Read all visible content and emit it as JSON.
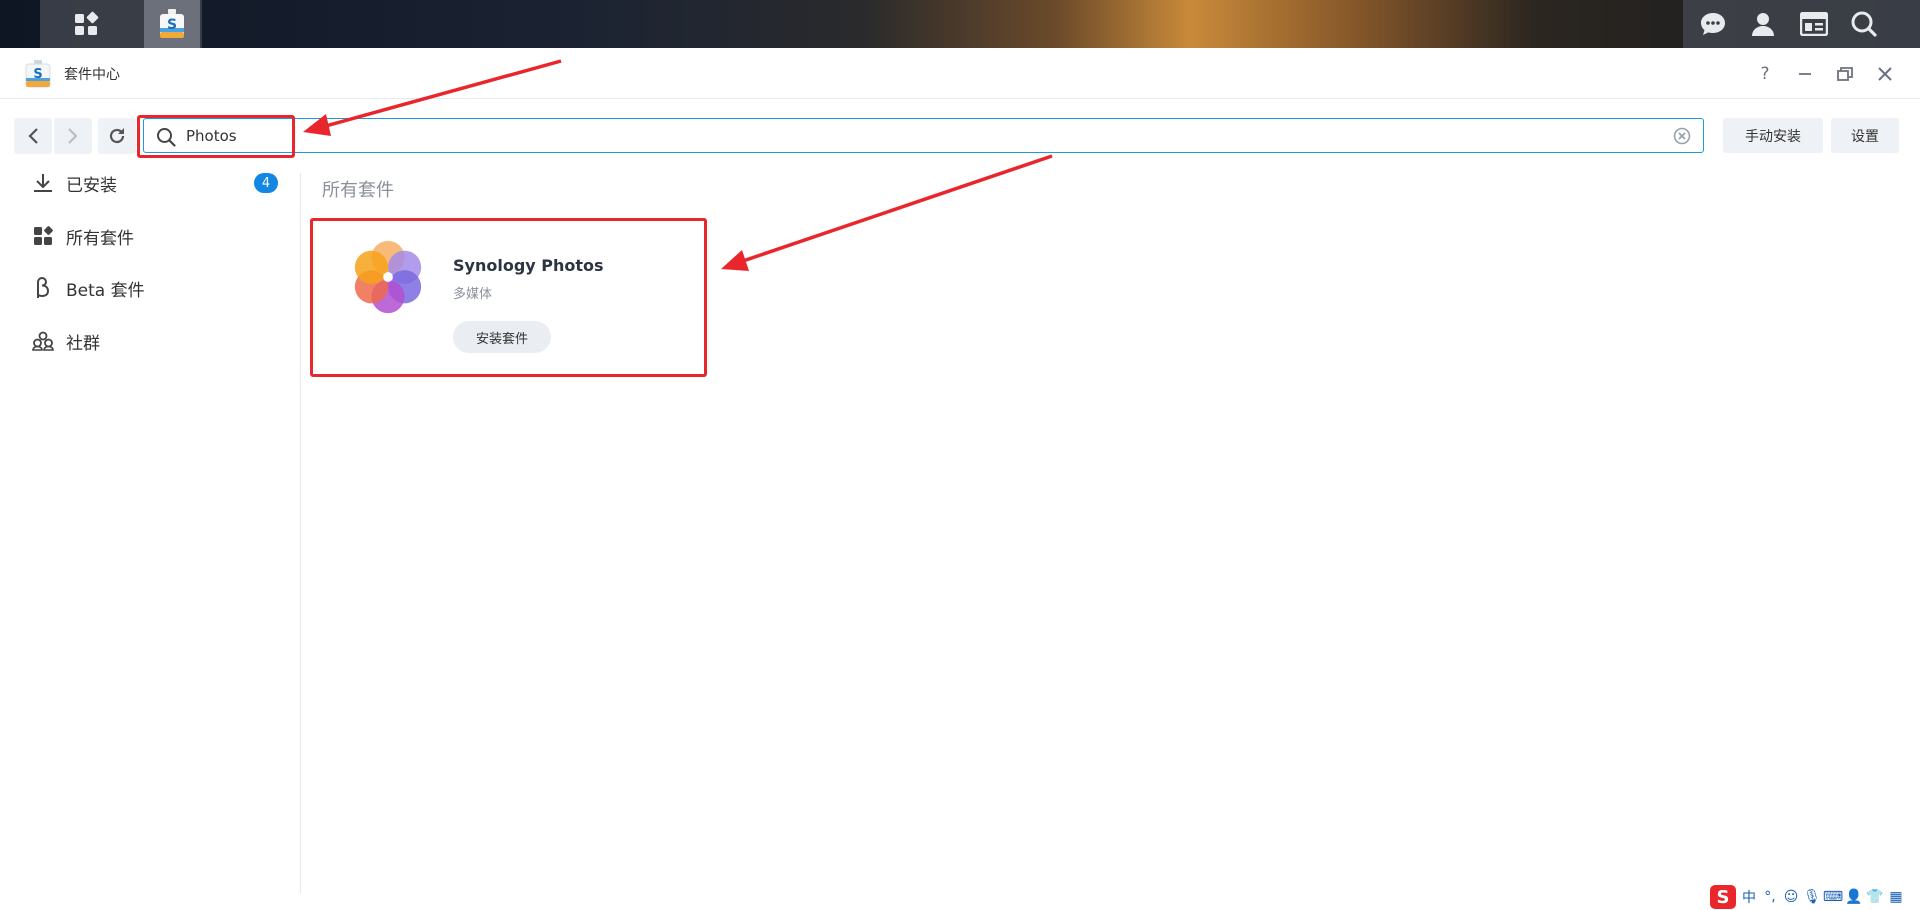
{
  "taskbar": {
    "left": [
      {
        "name": "main-menu-icon"
      },
      {
        "name": "package-center-taskbar-icon",
        "active": true
      }
    ],
    "right": [
      {
        "name": "chat-icon"
      },
      {
        "name": "user-icon"
      },
      {
        "name": "widgets-icon"
      },
      {
        "name": "search-icon"
      }
    ]
  },
  "window": {
    "title": "套件中心",
    "controls": {
      "help": "?",
      "minimize": "—",
      "restore": "❐",
      "close": "✕"
    }
  },
  "toolbar": {
    "search": {
      "value": "Photos",
      "placeholder": ""
    },
    "manual_install_label": "手动安装",
    "settings_label": "设置"
  },
  "sidebar": {
    "items": [
      {
        "label": "已安装",
        "icon": "download-icon",
        "badge": "4"
      },
      {
        "label": "所有套件",
        "icon": "grid-icon"
      },
      {
        "label": "Beta 套件",
        "icon": "beta-icon"
      },
      {
        "label": "社群",
        "icon": "community-icon"
      }
    ]
  },
  "main": {
    "section_title": "所有套件",
    "packages": [
      {
        "name": "Synology Photos",
        "category": "多媒体",
        "action_label": "安装套件"
      }
    ]
  },
  "ime": {
    "logo": "S",
    "lang": "中",
    "punct": "°,"
  },
  "colors": {
    "accent": "#1287e3",
    "annotation": "#e8262b",
    "search_border": "#1d9bd8"
  }
}
